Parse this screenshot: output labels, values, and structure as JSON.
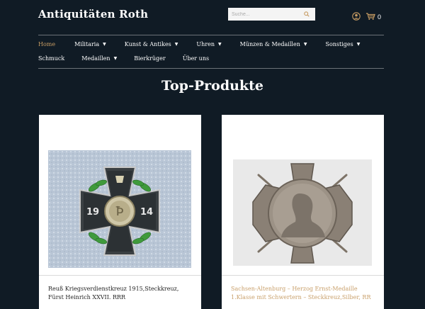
{
  "header": {
    "site_title": "Antiquitäten Roth",
    "search_placeholder": "Suche...",
    "cart_count": "0"
  },
  "nav": {
    "row1": [
      {
        "label": "Home",
        "dropdown": false,
        "active": true
      },
      {
        "label": "Militaria",
        "dropdown": true
      },
      {
        "label": "Kunst & Antikes",
        "dropdown": true
      },
      {
        "label": "Uhren",
        "dropdown": true
      },
      {
        "label": "Münzen & Medaillen",
        "dropdown": true
      },
      {
        "label": "Sonstiges",
        "dropdown": true
      }
    ],
    "row2": [
      {
        "label": "Schmuck",
        "dropdown": false
      },
      {
        "label": "Medaillen",
        "dropdown": true
      },
      {
        "label": "Bierkrüger",
        "dropdown": false
      },
      {
        "label": "Über uns",
        "dropdown": false
      }
    ]
  },
  "main": {
    "heading": "Top-Produkte",
    "products": [
      {
        "name": "Reuß Kriegsverdienstkreuz 1915,Steckkreuz, Fürst Heinrich XXVII. RRR",
        "image_year_left": "19",
        "image_year_right": "14"
      },
      {
        "name": "Sachsen-Altenburg – Herzog Ernst-Medaille 1.Klasse mit Schwertern – Steckkreuz,Silber, RR"
      }
    ]
  },
  "colors": {
    "background": "#101b25",
    "accent": "#c79c63"
  }
}
